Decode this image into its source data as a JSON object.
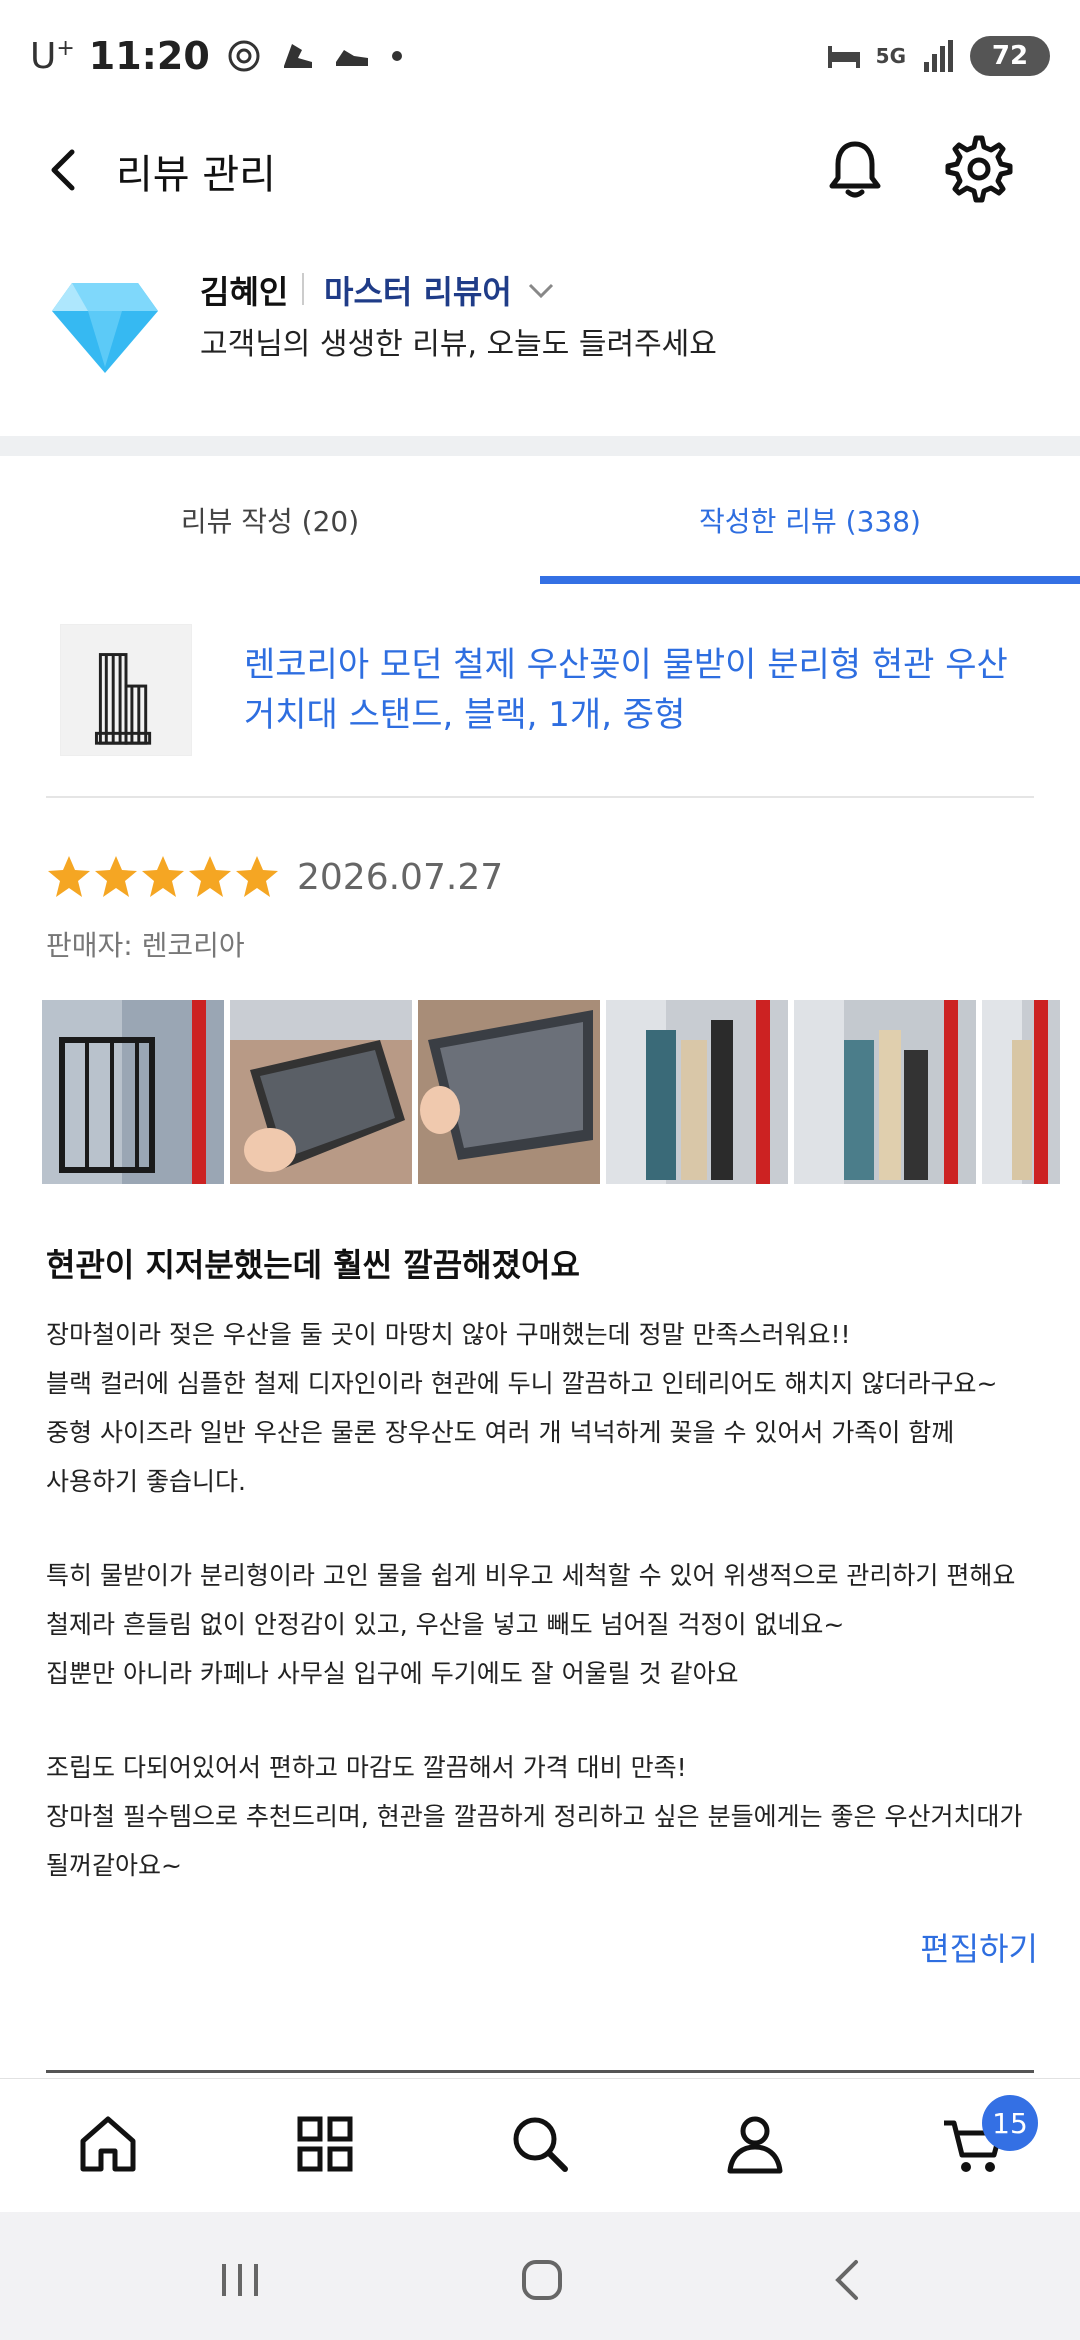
{
  "status_bar": {
    "carrier": "U",
    "carrier_sup": "+",
    "time": "11:20",
    "network": "5G",
    "battery": "72"
  },
  "header": {
    "title": "리뷰 관리"
  },
  "profile": {
    "name": "김혜인",
    "grade": "마스터 리뷰어",
    "message": "고객님의 생생한 리뷰, 오늘도 들려주세요"
  },
  "tabs": [
    {
      "label": "리뷰 작성 (20)",
      "active": false
    },
    {
      "label": "작성한 리뷰 (338)",
      "active": true
    }
  ],
  "product": {
    "name": "렌코리아 모던 철제 우산꽂이 물받이 분리형 현관 우산 거치대 스탠드, 블랙, 1개, 중형"
  },
  "review": {
    "rating": 5,
    "date": "2026.07.27",
    "seller": "판매자: 렌코리아",
    "photo_count": 6,
    "title": "현관이 지저분했는데 훨씬 깔끔해졌어요",
    "lines": [
      "장마철이라 젖은 우산을 둘 곳이 마땅치 않아 구매했는데 정말 만족스러워요!!",
      "블랙 컬러에 심플한 철제 디자인이라 현관에 두니 깔끔하고 인테리어도 해치지 않더라구요~",
      "중형 사이즈라 일반 우산은 물론 장우산도 여러 개 넉넉하게 꽂을 수 있어서 가족이 함께",
      "사용하기 좋습니다.",
      "",
      "특히 물받이가 분리형이라 고인 물을 쉽게 비우고 세척할 수 있어 위생적으로 관리하기 편해요",
      "철제라 흔들림 없이 안정감이 있고, 우산을 넣고 빼도 넘어질 걱정이 없네요~",
      "집뿐만 아니라 카페나 사무실 입구에 두기에도 잘 어울릴 것 같아요",
      "",
      "조립도 다되어있어서 편하고 마감도 깔끔해서 가격 대비 만족!",
      "장마철 필수템으로 추천드리며, 현관을 깔끔하게 정리하고 싶은 분들에게는 좋은 우산거치대가",
      "될꺼같아요~"
    ],
    "edit_label": "편집하기"
  },
  "bottom_nav": {
    "items": [
      "home-icon",
      "category-icon",
      "search-icon",
      "profile-icon",
      "cart-icon"
    ],
    "cart_count": "15"
  },
  "colors": {
    "accent": "#3470e4",
    "grade": "#1f3c88",
    "star": "#f5a623"
  }
}
